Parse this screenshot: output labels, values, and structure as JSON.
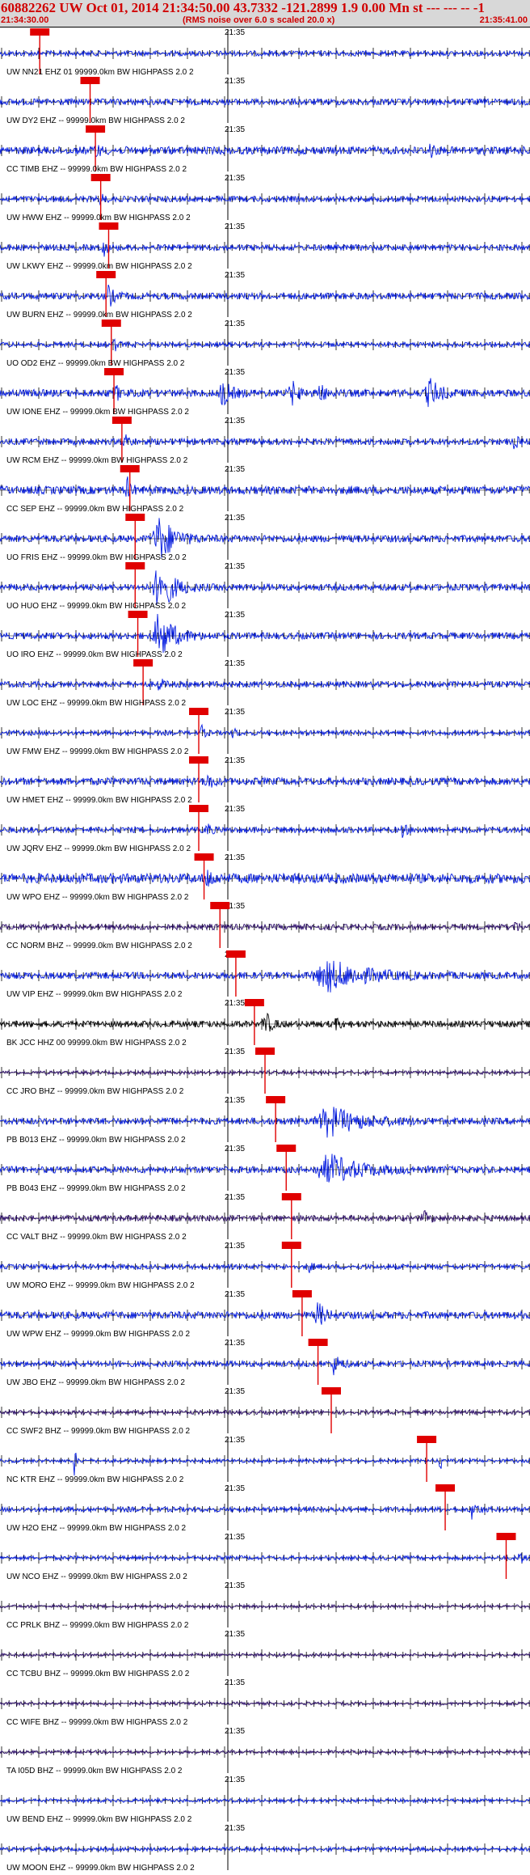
{
  "header": {
    "title": "60882262 UW Oct 01, 2014 21:34:50.00   43.7332 -121.2899  1.9 0.00 Mn st --- --- --  -1",
    "start_time": "21:34:30.00",
    "rms_note": "(RMS noise over 6.0 s scaled 20.0 x)",
    "end_time": "21:35:41.00"
  },
  "minute_label": "21:35",
  "colors": {
    "trace_blue": "#0018e0",
    "trace_purple": "#2a0a6a",
    "trace_black": "#000000",
    "pick_red": "#e00000",
    "header_bg": "#d8d8d8"
  },
  "traces": [
    {
      "label": "UW NN21 EHZ 01 99999.0km BW  HIGHPASS  2.0  2",
      "pick": 0.075,
      "color": "blue",
      "noise": 3.2,
      "events": []
    },
    {
      "label": "UW DY2 EHZ -- 99999.0km BW  HIGHPASS  2.0  2",
      "pick": 0.17,
      "color": "blue",
      "noise": 3.8,
      "events": []
    },
    {
      "label": "CC TIMB EHZ -- 99999.0km BW  HIGHPASS  2.0  2",
      "pick": 0.18,
      "color": "blue",
      "noise": 4.8,
      "events": [
        {
          "c": 0.18,
          "w": 0.012,
          "a": 9
        },
        {
          "c": 0.81,
          "w": 0.012,
          "a": 12
        }
      ]
    },
    {
      "label": "UW HWW EHZ -- 99999.0km BW  HIGHPASS  2.0  2",
      "pick": 0.19,
      "color": "blue",
      "noise": 3.5,
      "events": [
        {
          "c": 0.19,
          "w": 0.01,
          "a": 8
        }
      ]
    },
    {
      "label": "UW LKWY EHZ -- 99999.0km BW  HIGHPASS  2.0  2",
      "pick": 0.205,
      "color": "blue",
      "noise": 3.6,
      "events": [
        {
          "c": 0.195,
          "w": 0.012,
          "a": 11
        }
      ]
    },
    {
      "label": "UW BURN EHZ -- 99999.0km BW  HIGHPASS  2.0  2",
      "pick": 0.2,
      "color": "blue",
      "noise": 4.0,
      "events": [
        {
          "c": 0.205,
          "w": 0.015,
          "a": 14
        }
      ]
    },
    {
      "label": "UO OD2 EHZ -- 99999.0km BW  HIGHPASS  2.0  2",
      "pick": 0.21,
      "color": "blue",
      "noise": 3.0,
      "events": [
        {
          "c": 0.215,
          "w": 0.01,
          "a": 10
        }
      ]
    },
    {
      "label": "UW IONE EHZ -- 99999.0km BW  HIGHPASS  2.0  2",
      "pick": 0.215,
      "color": "blue",
      "noise": 4.5,
      "events": [
        {
          "c": 0.22,
          "w": 0.012,
          "a": 9
        },
        {
          "c": 0.42,
          "w": 0.025,
          "a": 16
        },
        {
          "c": 0.55,
          "w": 0.02,
          "a": 15
        },
        {
          "c": 0.6,
          "w": 0.02,
          "a": 13
        },
        {
          "c": 0.81,
          "w": 0.03,
          "a": 18
        }
      ]
    },
    {
      "label": "UW RCM EHZ -- 99999.0km BW  HIGHPASS  2.0  2",
      "pick": 0.23,
      "color": "blue",
      "noise": 3.8,
      "events": [
        {
          "c": 0.235,
          "w": 0.012,
          "a": 12
        },
        {
          "c": 0.97,
          "w": 0.012,
          "a": 9
        }
      ]
    },
    {
      "label": "CC SEP EHZ -- 99999.0km BW  HIGHPASS  2.0  2",
      "pick": 0.245,
      "color": "blue",
      "noise": 5.0,
      "events": [
        {
          "c": 0.24,
          "w": 0.012,
          "a": 14
        }
      ]
    },
    {
      "label": "UO FRIS EHZ -- 99999.0km BW  HIGHPASS  2.0  2",
      "pick": 0.255,
      "color": "blue",
      "noise": 4.2,
      "events": [
        {
          "c": 0.3,
          "w": 0.045,
          "a": 30
        }
      ]
    },
    {
      "label": "UO HUO EHZ -- 99999.0km BW  HIGHPASS  2.0  2",
      "pick": 0.255,
      "color": "blue",
      "noise": 4.0,
      "events": [
        {
          "c": 0.3,
          "w": 0.045,
          "a": 30
        }
      ]
    },
    {
      "label": "UO IRO EHZ -- 99999.0km BW  HIGHPASS  2.0  2",
      "pick": 0.26,
      "color": "blue",
      "noise": 4.0,
      "events": [
        {
          "c": 0.3,
          "w": 0.045,
          "a": 30
        }
      ]
    },
    {
      "label": "UW LOC EHZ -- 99999.0km BW  HIGHPASS  2.0  2",
      "pick": 0.27,
      "color": "blue",
      "noise": 3.5,
      "events": [
        {
          "c": 0.3,
          "w": 0.012,
          "a": 9
        }
      ]
    },
    {
      "label": "UW FMW EHZ -- 99999.0km BW  HIGHPASS  2.0  2",
      "pick": 0.375,
      "color": "blue",
      "noise": 2.8,
      "events": [
        {
          "c": 0.38,
          "w": 0.01,
          "a": 9
        },
        {
          "c": 0.44,
          "w": 0.01,
          "a": 8
        }
      ]
    },
    {
      "label": "UW HMET EHZ -- 99999.0km BW  HIGHPASS  2.0  2",
      "pick": 0.375,
      "color": "blue",
      "noise": 4.5,
      "events": [
        {
          "c": 0.39,
          "w": 0.015,
          "a": 11
        }
      ]
    },
    {
      "label": "UW JQRV EHZ -- 99999.0km BW  HIGHPASS  2.0  2",
      "pick": 0.375,
      "color": "blue",
      "noise": 3.5,
      "events": [
        {
          "c": 0.39,
          "w": 0.012,
          "a": 10
        },
        {
          "c": 0.76,
          "w": 0.012,
          "a": 9
        }
      ]
    },
    {
      "label": "UW WPO EHZ -- 99999.0km BW  HIGHPASS  2.0  2",
      "pick": 0.385,
      "color": "blue",
      "noise": 6.0,
      "events": [
        {
          "c": 0.39,
          "w": 0.015,
          "a": 13
        }
      ]
    },
    {
      "label": "CC NORM BHZ -- 99999.0km BW  HIGHPASS  2.0  2",
      "pick": 0.415,
      "color": "purple",
      "noise": 3.5,
      "events": [
        {
          "c": 0.97,
          "w": 0.012,
          "a": 8
        }
      ]
    },
    {
      "label": "UW VIP EHZ -- 99999.0km BW  HIGHPASS  2.0  2",
      "pick": 0.445,
      "color": "blue",
      "noise": 4.0,
      "events": [
        {
          "c": 0.62,
          "w": 0.12,
          "a": 18
        }
      ]
    },
    {
      "label": "BK JCC HHZ 00 99999.0km BW  HIGHPASS  2.0  2",
      "pick": 0.48,
      "color": "black",
      "noise": 3.8,
      "events": [
        {
          "c": 0.5,
          "w": 0.02,
          "a": 15
        },
        {
          "c": 0.63,
          "w": 0.015,
          "a": 8
        }
      ]
    },
    {
      "label": "CC JRO BHZ -- 99999.0km BW  HIGHPASS  2.0  2",
      "pick": 0.5,
      "color": "purple",
      "noise": 2.2,
      "events": []
    },
    {
      "label": "PB B013 EHZ -- 99999.0km BW  HIGHPASS  2.0  2",
      "pick": 0.52,
      "color": "blue",
      "noise": 4.0,
      "events": [
        {
          "c": 0.62,
          "w": 0.1,
          "a": 18
        }
      ]
    },
    {
      "label": "PB B043 EHZ -- 99999.0km BW  HIGHPASS  2.0  2",
      "pick": 0.54,
      "color": "blue",
      "noise": 4.0,
      "events": [
        {
          "c": 0.62,
          "w": 0.1,
          "a": 18
        }
      ]
    },
    {
      "label": "CC VALT BHZ -- 99999.0km BW  HIGHPASS  2.0  2",
      "pick": 0.55,
      "color": "purple",
      "noise": 3.5,
      "events": [
        {
          "c": 0.8,
          "w": 0.02,
          "a": 7
        }
      ]
    },
    {
      "label": "UW MORO EHZ -- 99999.0km BW  HIGHPASS  2.0  2",
      "pick": 0.55,
      "color": "blue",
      "noise": 3.0,
      "events": [
        {
          "c": 0.58,
          "w": 0.01,
          "a": 10
        }
      ]
    },
    {
      "label": "UW WPW EHZ -- 99999.0km BW  HIGHPASS  2.0  2",
      "pick": 0.57,
      "color": "blue",
      "noise": 4.5,
      "events": [
        {
          "c": 0.6,
          "w": 0.02,
          "a": 16
        }
      ]
    },
    {
      "label": "UW JBO EHZ -- 99999.0km BW  HIGHPASS  2.0  2",
      "pick": 0.6,
      "color": "blue",
      "noise": 3.5,
      "events": [
        {
          "c": 0.63,
          "w": 0.02,
          "a": 12
        }
      ]
    },
    {
      "label": "CC SWF2 BHZ -- 99999.0km BW  HIGHPASS  2.0  2",
      "pick": 0.625,
      "color": "purple",
      "noise": 2.5,
      "events": []
    },
    {
      "label": "NC KTR EHZ -- 99999.0km BW  HIGHPASS  2.0  2",
      "pick": 0.805,
      "color": "blue",
      "noise": 2.2,
      "events": [
        {
          "c": 0.14,
          "w": 0.005,
          "a": 24
        },
        {
          "c": 0.83,
          "w": 0.006,
          "a": 22
        }
      ]
    },
    {
      "label": "UW H2O EHZ -- 99999.0km BW  HIGHPASS  2.0  2",
      "pick": 0.84,
      "color": "blue",
      "noise": 3.0,
      "events": [
        {
          "c": 0.89,
          "w": 0.02,
          "a": 10
        }
      ]
    },
    {
      "label": "UW NCO EHZ -- 99999.0km BW  HIGHPASS  2.0  2",
      "pick": 0.955,
      "color": "blue",
      "noise": 2.5,
      "events": [
        {
          "c": 0.98,
          "w": 0.01,
          "a": 10
        }
      ]
    },
    {
      "label": "CC PRLK BHZ -- 99999.0km BW  HIGHPASS  2.0  2",
      "pick": null,
      "color": "purple",
      "noise": 2.0,
      "events": []
    },
    {
      "label": "CC TCBU BHZ -- 99999.0km BW  HIGHPASS  2.0  2",
      "pick": null,
      "color": "purple",
      "noise": 2.0,
      "events": []
    },
    {
      "label": "CC WIFE BHZ -- 99999.0km BW  HIGHPASS  2.0  2",
      "pick": null,
      "color": "purple",
      "noise": 2.0,
      "events": []
    },
    {
      "label": "TA I05D BHZ -- 99999.0km BW  HIGHPASS  2.0  2",
      "pick": null,
      "color": "purple",
      "noise": 2.0,
      "events": []
    },
    {
      "label": "UW BEND EHZ -- 99999.0km BW  HIGHPASS  2.0  2",
      "pick": null,
      "color": "blue",
      "noise": 2.2,
      "events": []
    },
    {
      "label": "UW MOON EHZ -- 99999.0km BW  HIGHPASS  2.0  2",
      "pick": null,
      "color": "blue",
      "noise": 2.4,
      "events": []
    }
  ]
}
